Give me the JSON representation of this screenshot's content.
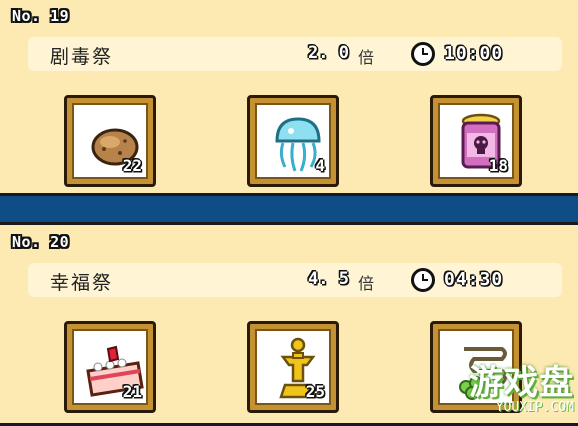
{
  "festivals": [
    {
      "number": "No. 19",
      "name": "剧毒祭",
      "multiplier": "2. 0",
      "multiplier_unit": "倍",
      "time": "10:00",
      "items": [
        {
          "icon": "potato-icon",
          "qty": "22"
        },
        {
          "icon": "jellyfish-icon",
          "qty": "4"
        },
        {
          "icon": "poison-jar-icon",
          "qty": "18"
        }
      ]
    },
    {
      "number": "No. 20",
      "name": "幸福祭",
      "multiplier": "4. 5",
      "multiplier_unit": "倍",
      "time": "04:30",
      "items": [
        {
          "icon": "strawberry-cake-icon",
          "qty": "21"
        },
        {
          "icon": "gold-trophy-icon",
          "qty": "25"
        },
        {
          "icon": "clover-scroll-icon",
          "qty": ""
        }
      ]
    }
  ],
  "watermark": {
    "main": "游戏盘",
    "sub": "YOUXIP.COM"
  },
  "colors": {
    "card_bg": "#fde9b2",
    "info_bar_bg": "#fff5d4",
    "divider": "#0e4d86",
    "slot_frame": "#c49233"
  }
}
